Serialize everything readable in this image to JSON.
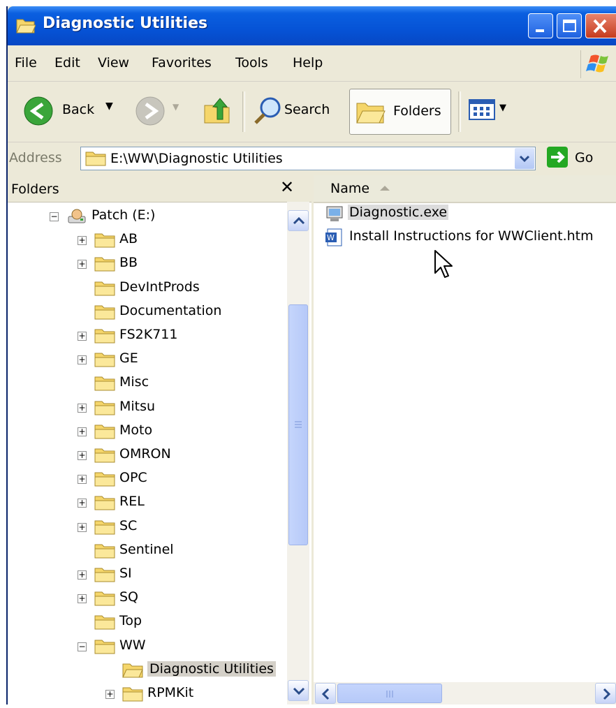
{
  "window": {
    "title": "Diagnostic Utilities",
    "controls": [
      "minimize",
      "maximize",
      "close"
    ]
  },
  "menubar": {
    "items": [
      "File",
      "Edit",
      "View",
      "Favorites",
      "Tools",
      "Help"
    ]
  },
  "toolbar": {
    "back_label": "Back",
    "search_label": "Search",
    "folders_label": "Folders"
  },
  "address": {
    "label": "Address",
    "value": "E:\\WW\\Diagnostic Utilities",
    "go_label": "Go"
  },
  "folders_pane": {
    "title": "Folders",
    "close_glyph": "✕",
    "tree": [
      {
        "label": "Patch (E:)",
        "depth": 0,
        "expander": "minus",
        "icon": "drive-icon"
      },
      {
        "label": "AB",
        "depth": 1,
        "expander": "plus",
        "icon": "folder-icon"
      },
      {
        "label": "BB",
        "depth": 1,
        "expander": "plus",
        "icon": "folder-icon"
      },
      {
        "label": "DevIntProds",
        "depth": 1,
        "expander": "none",
        "icon": "folder-icon"
      },
      {
        "label": "Documentation",
        "depth": 1,
        "expander": "none",
        "icon": "folder-icon"
      },
      {
        "label": "FS2K711",
        "depth": 1,
        "expander": "plus",
        "icon": "folder-icon"
      },
      {
        "label": "GE",
        "depth": 1,
        "expander": "plus",
        "icon": "folder-icon"
      },
      {
        "label": "Misc",
        "depth": 1,
        "expander": "none",
        "icon": "folder-icon"
      },
      {
        "label": "Mitsu",
        "depth": 1,
        "expander": "plus",
        "icon": "folder-icon"
      },
      {
        "label": "Moto",
        "depth": 1,
        "expander": "plus",
        "icon": "folder-icon"
      },
      {
        "label": "OMRON",
        "depth": 1,
        "expander": "plus",
        "icon": "folder-icon"
      },
      {
        "label": "OPC",
        "depth": 1,
        "expander": "plus",
        "icon": "folder-icon"
      },
      {
        "label": "REL",
        "depth": 1,
        "expander": "plus",
        "icon": "folder-icon"
      },
      {
        "label": "SC",
        "depth": 1,
        "expander": "plus",
        "icon": "folder-icon"
      },
      {
        "label": "Sentinel",
        "depth": 1,
        "expander": "none",
        "icon": "folder-icon"
      },
      {
        "label": "SI",
        "depth": 1,
        "expander": "plus",
        "icon": "folder-icon"
      },
      {
        "label": "SQ",
        "depth": 1,
        "expander": "plus",
        "icon": "folder-icon"
      },
      {
        "label": "Top",
        "depth": 1,
        "expander": "none",
        "icon": "folder-icon"
      },
      {
        "label": "WW",
        "depth": 1,
        "expander": "minus",
        "icon": "folder-icon"
      },
      {
        "label": "Diagnostic Utilities",
        "depth": 2,
        "expander": "none",
        "icon": "open-folder-icon",
        "selected": true
      },
      {
        "label": "RPMKit",
        "depth": 2,
        "expander": "plus",
        "icon": "folder-icon"
      }
    ]
  },
  "files_pane": {
    "column_name": "Name",
    "files": [
      {
        "label": "Diagnostic.exe",
        "icon": "exe-icon",
        "highlighted": true
      },
      {
        "label": "Install Instructions for WWClient.htm",
        "icon": "word-doc-icon",
        "highlighted": false
      }
    ]
  }
}
